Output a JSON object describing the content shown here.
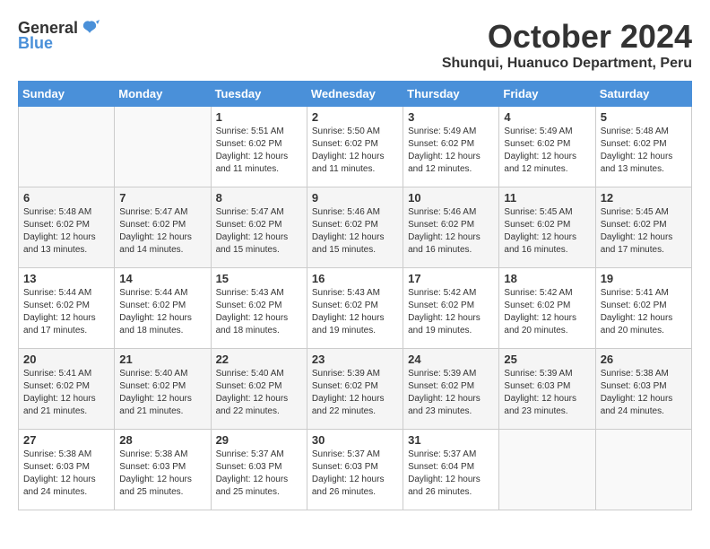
{
  "header": {
    "logo_general": "General",
    "logo_blue": "Blue",
    "month_title": "October 2024",
    "location": "Shunqui, Huanuco Department, Peru"
  },
  "calendar": {
    "days_of_week": [
      "Sunday",
      "Monday",
      "Tuesday",
      "Wednesday",
      "Thursday",
      "Friday",
      "Saturday"
    ],
    "weeks": [
      [
        {
          "day": "",
          "sunrise": "",
          "sunset": "",
          "daylight": ""
        },
        {
          "day": "",
          "sunrise": "",
          "sunset": "",
          "daylight": ""
        },
        {
          "day": "1",
          "sunrise": "Sunrise: 5:51 AM",
          "sunset": "Sunset: 6:02 PM",
          "daylight": "Daylight: 12 hours and 11 minutes."
        },
        {
          "day": "2",
          "sunrise": "Sunrise: 5:50 AM",
          "sunset": "Sunset: 6:02 PM",
          "daylight": "Daylight: 12 hours and 11 minutes."
        },
        {
          "day": "3",
          "sunrise": "Sunrise: 5:49 AM",
          "sunset": "Sunset: 6:02 PM",
          "daylight": "Daylight: 12 hours and 12 minutes."
        },
        {
          "day": "4",
          "sunrise": "Sunrise: 5:49 AM",
          "sunset": "Sunset: 6:02 PM",
          "daylight": "Daylight: 12 hours and 12 minutes."
        },
        {
          "day": "5",
          "sunrise": "Sunrise: 5:48 AM",
          "sunset": "Sunset: 6:02 PM",
          "daylight": "Daylight: 12 hours and 13 minutes."
        }
      ],
      [
        {
          "day": "6",
          "sunrise": "Sunrise: 5:48 AM",
          "sunset": "Sunset: 6:02 PM",
          "daylight": "Daylight: 12 hours and 13 minutes."
        },
        {
          "day": "7",
          "sunrise": "Sunrise: 5:47 AM",
          "sunset": "Sunset: 6:02 PM",
          "daylight": "Daylight: 12 hours and 14 minutes."
        },
        {
          "day": "8",
          "sunrise": "Sunrise: 5:47 AM",
          "sunset": "Sunset: 6:02 PM",
          "daylight": "Daylight: 12 hours and 15 minutes."
        },
        {
          "day": "9",
          "sunrise": "Sunrise: 5:46 AM",
          "sunset": "Sunset: 6:02 PM",
          "daylight": "Daylight: 12 hours and 15 minutes."
        },
        {
          "day": "10",
          "sunrise": "Sunrise: 5:46 AM",
          "sunset": "Sunset: 6:02 PM",
          "daylight": "Daylight: 12 hours and 16 minutes."
        },
        {
          "day": "11",
          "sunrise": "Sunrise: 5:45 AM",
          "sunset": "Sunset: 6:02 PM",
          "daylight": "Daylight: 12 hours and 16 minutes."
        },
        {
          "day": "12",
          "sunrise": "Sunrise: 5:45 AM",
          "sunset": "Sunset: 6:02 PM",
          "daylight": "Daylight: 12 hours and 17 minutes."
        }
      ],
      [
        {
          "day": "13",
          "sunrise": "Sunrise: 5:44 AM",
          "sunset": "Sunset: 6:02 PM",
          "daylight": "Daylight: 12 hours and 17 minutes."
        },
        {
          "day": "14",
          "sunrise": "Sunrise: 5:44 AM",
          "sunset": "Sunset: 6:02 PM",
          "daylight": "Daylight: 12 hours and 18 minutes."
        },
        {
          "day": "15",
          "sunrise": "Sunrise: 5:43 AM",
          "sunset": "Sunset: 6:02 PM",
          "daylight": "Daylight: 12 hours and 18 minutes."
        },
        {
          "day": "16",
          "sunrise": "Sunrise: 5:43 AM",
          "sunset": "Sunset: 6:02 PM",
          "daylight": "Daylight: 12 hours and 19 minutes."
        },
        {
          "day": "17",
          "sunrise": "Sunrise: 5:42 AM",
          "sunset": "Sunset: 6:02 PM",
          "daylight": "Daylight: 12 hours and 19 minutes."
        },
        {
          "day": "18",
          "sunrise": "Sunrise: 5:42 AM",
          "sunset": "Sunset: 6:02 PM",
          "daylight": "Daylight: 12 hours and 20 minutes."
        },
        {
          "day": "19",
          "sunrise": "Sunrise: 5:41 AM",
          "sunset": "Sunset: 6:02 PM",
          "daylight": "Daylight: 12 hours and 20 minutes."
        }
      ],
      [
        {
          "day": "20",
          "sunrise": "Sunrise: 5:41 AM",
          "sunset": "Sunset: 6:02 PM",
          "daylight": "Daylight: 12 hours and 21 minutes."
        },
        {
          "day": "21",
          "sunrise": "Sunrise: 5:40 AM",
          "sunset": "Sunset: 6:02 PM",
          "daylight": "Daylight: 12 hours and 21 minutes."
        },
        {
          "day": "22",
          "sunrise": "Sunrise: 5:40 AM",
          "sunset": "Sunset: 6:02 PM",
          "daylight": "Daylight: 12 hours and 22 minutes."
        },
        {
          "day": "23",
          "sunrise": "Sunrise: 5:39 AM",
          "sunset": "Sunset: 6:02 PM",
          "daylight": "Daylight: 12 hours and 22 minutes."
        },
        {
          "day": "24",
          "sunrise": "Sunrise: 5:39 AM",
          "sunset": "Sunset: 6:02 PM",
          "daylight": "Daylight: 12 hours and 23 minutes."
        },
        {
          "day": "25",
          "sunrise": "Sunrise: 5:39 AM",
          "sunset": "Sunset: 6:03 PM",
          "daylight": "Daylight: 12 hours and 23 minutes."
        },
        {
          "day": "26",
          "sunrise": "Sunrise: 5:38 AM",
          "sunset": "Sunset: 6:03 PM",
          "daylight": "Daylight: 12 hours and 24 minutes."
        }
      ],
      [
        {
          "day": "27",
          "sunrise": "Sunrise: 5:38 AM",
          "sunset": "Sunset: 6:03 PM",
          "daylight": "Daylight: 12 hours and 24 minutes."
        },
        {
          "day": "28",
          "sunrise": "Sunrise: 5:38 AM",
          "sunset": "Sunset: 6:03 PM",
          "daylight": "Daylight: 12 hours and 25 minutes."
        },
        {
          "day": "29",
          "sunrise": "Sunrise: 5:37 AM",
          "sunset": "Sunset: 6:03 PM",
          "daylight": "Daylight: 12 hours and 25 minutes."
        },
        {
          "day": "30",
          "sunrise": "Sunrise: 5:37 AM",
          "sunset": "Sunset: 6:03 PM",
          "daylight": "Daylight: 12 hours and 26 minutes."
        },
        {
          "day": "31",
          "sunrise": "Sunrise: 5:37 AM",
          "sunset": "Sunset: 6:04 PM",
          "daylight": "Daylight: 12 hours and 26 minutes."
        },
        {
          "day": "",
          "sunrise": "",
          "sunset": "",
          "daylight": ""
        },
        {
          "day": "",
          "sunrise": "",
          "sunset": "",
          "daylight": ""
        }
      ]
    ]
  }
}
